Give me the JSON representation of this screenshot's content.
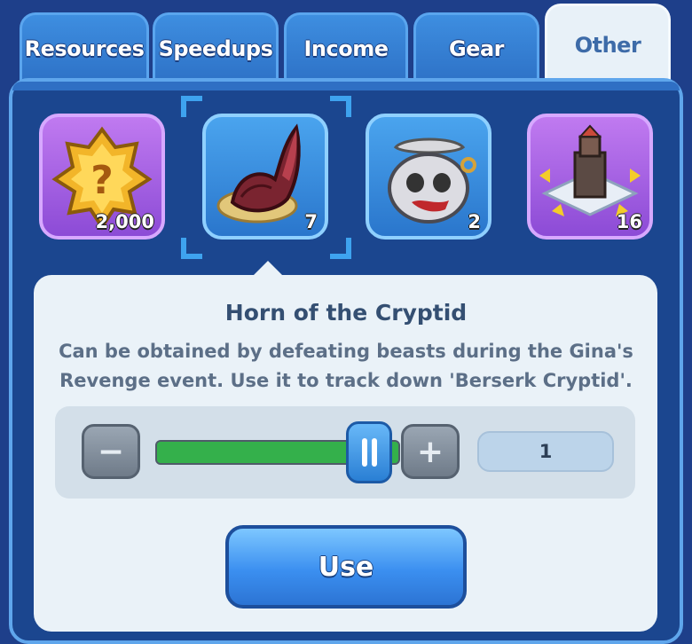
{
  "tabs": [
    {
      "label": "Resources"
    },
    {
      "label": "Speedups"
    },
    {
      "label": "Income"
    },
    {
      "label": "Gear"
    },
    {
      "label": "Other"
    }
  ],
  "active_tab": "Other",
  "items": [
    {
      "icon": "mystery-chest-icon",
      "count": "2,000",
      "rarity": "purple"
    },
    {
      "icon": "cryptid-horn-icon",
      "count": "7",
      "rarity": "blue",
      "selected": true
    },
    {
      "icon": "skull-sack-icon",
      "count": "2",
      "rarity": "blue"
    },
    {
      "icon": "tower-relocate-icon",
      "count": "16",
      "rarity": "purple"
    }
  ],
  "detail": {
    "title": "Horn of the Cryptid",
    "description": "Can be obtained by defeating beasts during the Gina's Revenge event. Use it to track down 'Berserk Cryptid'.",
    "quantity": "1",
    "slider_fraction": 1,
    "minus_label": "−",
    "plus_label": "+",
    "use_label": "Use"
  },
  "colors": {
    "background": "#1e3f8a",
    "accent_blue": "#3b8ff0",
    "progress_green": "#34b04b",
    "card": "#eaf2f8"
  }
}
